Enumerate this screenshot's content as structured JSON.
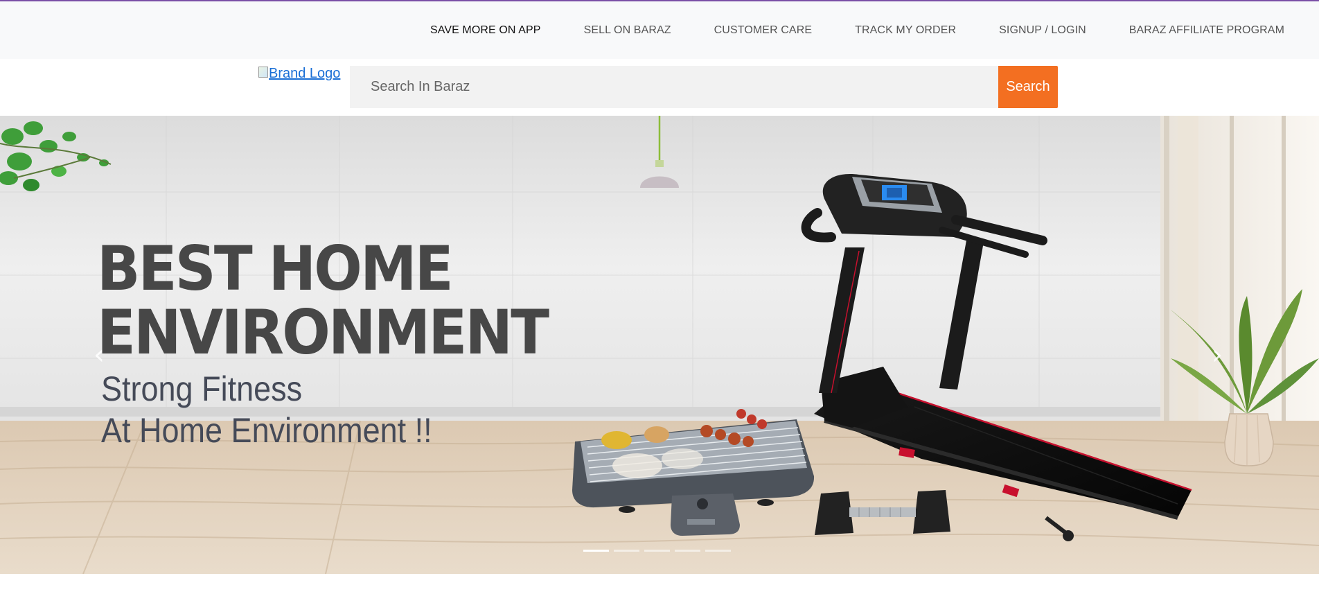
{
  "topnav": {
    "items": [
      {
        "label": "SAVE MORE ON APP"
      },
      {
        "label": "SELL ON BARAZ"
      },
      {
        "label": "CUSTOMER CARE"
      },
      {
        "label": "TRACK MY ORDER"
      },
      {
        "label": "SIGNUP / LOGIN"
      },
      {
        "label": "BARAZ AFFILIATE PROGRAM"
      }
    ]
  },
  "header": {
    "logo_alt": "Brand Logo",
    "search": {
      "placeholder": "Search In Baraz",
      "value": "",
      "button_label": "Search"
    }
  },
  "hero": {
    "headline_line1": "BEST HOME",
    "headline_line2": "ENVIRONMENT",
    "subline_line1": "Strong Fitness",
    "subline_line2": "At Home Environment !!",
    "prev_icon": "‹",
    "next_icon": "›",
    "slide_count": 5,
    "active_slide": 1
  },
  "colors": {
    "accent": "#f36f21",
    "top_border": "#7a4fa6",
    "link": "#1a6fd6"
  }
}
